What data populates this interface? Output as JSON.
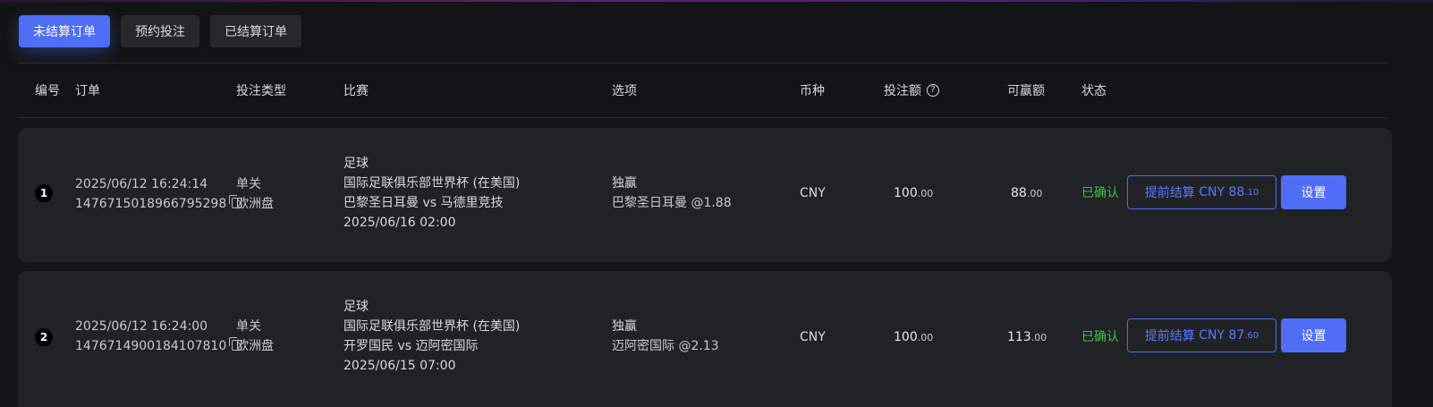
{
  "tabs": [
    {
      "label": "未结算订单",
      "active": true
    },
    {
      "label": "预约投注",
      "active": false
    },
    {
      "label": "已结算订单",
      "active": false
    }
  ],
  "table": {
    "headers": {
      "no": "编号",
      "order": "订单",
      "bet_type": "投注类型",
      "match": "比赛",
      "selection": "选项",
      "currency": "币种",
      "stake": "投注额",
      "stake_help": "?",
      "payout": "可赢额",
      "status": "状态"
    },
    "rows": [
      {
        "no": "1",
        "datetime": "2025/06/12 16:24:14",
        "order_id": "1476715018966795298",
        "bet_type": "单关",
        "odds_type": "欧洲盘",
        "sport": "足球",
        "league": "国际足联俱乐部世界杯 (在美国)",
        "teams": "巴黎圣日耳曼 vs 马德里竞技",
        "kickoff": "2025/06/16 02:00",
        "market": "独赢",
        "pick": "巴黎圣日耳曼 @1.88",
        "currency": "CNY",
        "stake_int": "100",
        "stake_dec": ".00",
        "payout_int": "88",
        "payout_dec": ".00",
        "status": "已确认",
        "cashout_label": "提前结算",
        "cashout_currency": "CNY",
        "cashout_int": "88",
        "cashout_dec": ".10",
        "settings_label": "设置"
      },
      {
        "no": "2",
        "datetime": "2025/06/12 16:24:00",
        "order_id": "1476714900184107810",
        "bet_type": "单关",
        "odds_type": "欧洲盘",
        "sport": "足球",
        "league": "国际足联俱乐部世界杯 (在美国)",
        "teams": "开罗国民 vs 迈阿密国际",
        "kickoff": "2025/06/15 07:00",
        "market": "独赢",
        "pick": "迈阿密国际 @2.13",
        "currency": "CNY",
        "stake_int": "100",
        "stake_dec": ".00",
        "payout_int": "113",
        "payout_dec": ".00",
        "status": "已确认",
        "cashout_label": "提前结算",
        "cashout_currency": "CNY",
        "cashout_int": "87",
        "cashout_dec": ".60",
        "settings_label": "设置"
      }
    ]
  },
  "colors": {
    "accent": "#4f6df5",
    "status_confirmed": "#3ec14a",
    "background": "#131416",
    "row_background": "#212226"
  }
}
